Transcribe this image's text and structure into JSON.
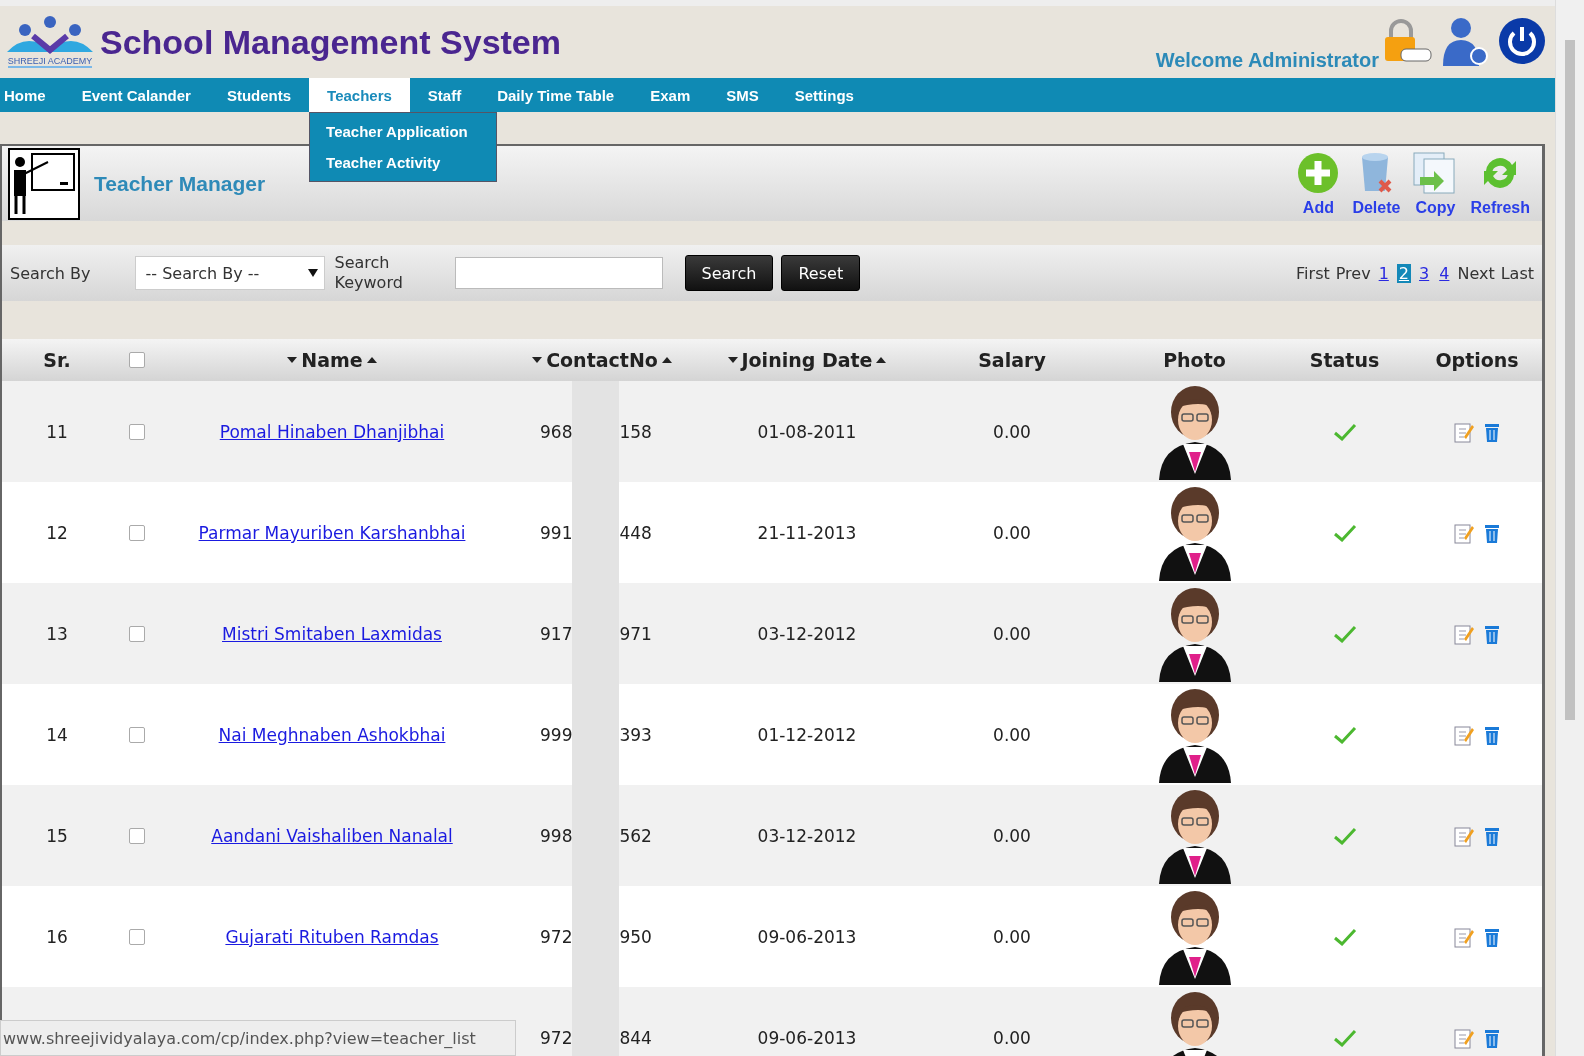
{
  "header": {
    "logo_text": "SHREEJI ACADEMY",
    "title": "School Management System",
    "welcome": "Welcome Administrator"
  },
  "nav": [
    {
      "label": "Home",
      "selected": false
    },
    {
      "label": "Event Calander",
      "selected": false
    },
    {
      "label": "Students",
      "selected": false
    },
    {
      "label": "Teachers",
      "selected": true,
      "menu": [
        "Teacher Application",
        "Teacher Activity"
      ]
    },
    {
      "label": "Staff",
      "selected": false
    },
    {
      "label": "Daily Time Table",
      "selected": false
    },
    {
      "label": "Exam",
      "selected": false
    },
    {
      "label": "SMS",
      "selected": false
    },
    {
      "label": "Settings",
      "selected": false
    }
  ],
  "panel": {
    "title": "Teacher Manager",
    "actions": [
      {
        "kind": "add",
        "label": "Add"
      },
      {
        "kind": "delete",
        "label": "Delete"
      },
      {
        "kind": "copy",
        "label": "Copy"
      },
      {
        "kind": "refresh",
        "label": "Refresh"
      }
    ]
  },
  "search": {
    "by_label": "Search By",
    "select_value": "-- Search By --",
    "keyword_label": "Search Keyword",
    "buttons": [
      "Search",
      "Reset"
    ]
  },
  "pager": {
    "first": "First",
    "prev": "Prev",
    "pages": [
      {
        "label": "1",
        "selected": false
      },
      {
        "label": "2",
        "selected": true
      },
      {
        "label": "3",
        "selected": false
      },
      {
        "label": "4",
        "selected": false
      }
    ],
    "next": "Next",
    "last": "Last"
  },
  "table": {
    "columns": [
      {
        "label": "Sr.",
        "sortable": false
      },
      {
        "kind": "checkbox",
        "checked": false
      },
      {
        "label": "Name",
        "sortable": true
      },
      {
        "label": "ContactNo",
        "sortable": true
      },
      {
        "label": "Joining Date",
        "sortable": true
      },
      {
        "label": "Salary",
        "sortable": false
      },
      {
        "label": "Photo",
        "sortable": false
      },
      {
        "label": "Status",
        "sortable": false
      },
      {
        "label": "Options",
        "sortable": false
      }
    ],
    "rows": [
      {
        "sr": "11",
        "checked": false,
        "name": "Pomal Hinaben Dhanjibhai",
        "contact_start": "968",
        "contact_end": "158",
        "joining": "01-08-2011",
        "salary": "0.00",
        "active": true
      },
      {
        "sr": "12",
        "checked": false,
        "name": "Parmar Mayuriben Karshanbhai",
        "contact_start": "991",
        "contact_end": "448",
        "joining": "21-11-2013",
        "salary": "0.00",
        "active": true
      },
      {
        "sr": "13",
        "checked": false,
        "name": "Mistri Smitaben Laxmidas",
        "contact_start": "917",
        "contact_end": "971",
        "joining": "03-12-2012",
        "salary": "0.00",
        "active": true
      },
      {
        "sr": "14",
        "checked": false,
        "name": "Nai Meghnaben Ashokbhai",
        "contact_start": "999",
        "contact_end": "393",
        "joining": "01-12-2012",
        "salary": "0.00",
        "active": true
      },
      {
        "sr": "15",
        "checked": false,
        "name": "Aandani Vaishaliben Nanalal",
        "contact_start": "998",
        "contact_end": "562",
        "joining": "03-12-2012",
        "salary": "0.00",
        "active": true
      },
      {
        "sr": "16",
        "checked": false,
        "name": "Gujarati Rituben Ramdas",
        "contact_start": "972",
        "contact_end": "950",
        "joining": "09-06-2013",
        "salary": "0.00",
        "active": true
      },
      {
        "contact_start": "972",
        "contact_end": "844",
        "joining": "09-06-2013",
        "salary": "0.00",
        "active": true
      }
    ]
  },
  "status_url": "www.shreejividyalaya.com/cp/index.php?view=teacher_list"
}
